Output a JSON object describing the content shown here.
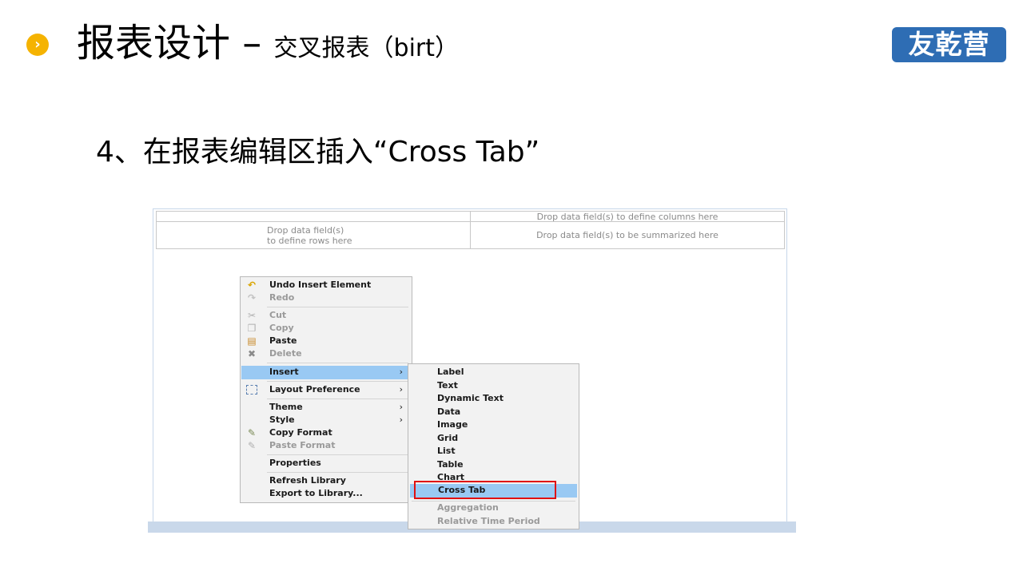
{
  "header": {
    "bullet_glyph": "›",
    "title_main": "报表设计",
    "title_dash": " – ",
    "title_sub": "交叉报表（birt）",
    "logo_text": "友乾营",
    "logo_color": "#2e6db4",
    "bullet_color": "#f5b301"
  },
  "step_text": "4、在报表编辑区插入“Cross Tab”",
  "crosstab": {
    "columns_hint": "Drop data field(s) to define columns here",
    "rows_hint_line1": "Drop data field(s)",
    "rows_hint_line2": "to define rows here",
    "summary_hint": "Drop data field(s) to be summarized here"
  },
  "context_menu": {
    "items": [
      {
        "label": "Undo Insert Element",
        "icon": "undo-icon"
      },
      {
        "label": "Redo",
        "icon": "redo-icon",
        "disabled": true
      },
      {
        "label": "Cut",
        "icon": "cut-icon",
        "disabled": true
      },
      {
        "label": "Copy",
        "icon": "copy-icon",
        "disabled": true
      },
      {
        "label": "Paste",
        "icon": "paste-icon"
      },
      {
        "label": "Delete",
        "icon": "delete-icon",
        "disabled": true
      },
      {
        "label": "Insert",
        "submenu": true,
        "highlighted": true
      },
      {
        "label": "Layout Preference",
        "icon": "layout-icon",
        "submenu": true
      },
      {
        "label": "Theme",
        "submenu": true
      },
      {
        "label": "Style",
        "submenu": true
      },
      {
        "label": "Copy Format",
        "icon": "copy-format-icon"
      },
      {
        "label": "Paste Format",
        "icon": "paste-format-icon",
        "disabled": true
      },
      {
        "label": "Properties"
      },
      {
        "label": "Refresh Library"
      },
      {
        "label": "Export to Library..."
      }
    ],
    "arrow_glyph": "›"
  },
  "insert_submenu": {
    "items": [
      "Label",
      "Text",
      "Dynamic Text",
      "Data",
      "Image",
      "Grid",
      "List",
      "Table",
      "Chart",
      "Cross Tab",
      "Aggregation",
      "Relative Time Period"
    ],
    "selected": "Cross Tab",
    "disabled": [
      "Aggregation",
      "Relative Time Period"
    ]
  }
}
